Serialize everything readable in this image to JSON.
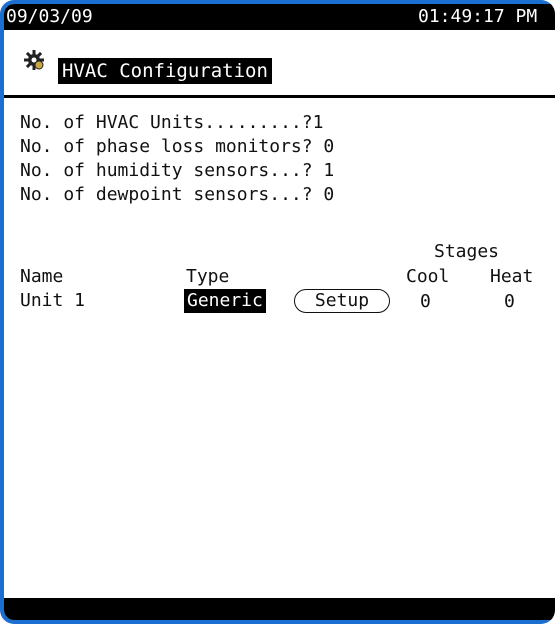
{
  "status": {
    "date": "09/03/09",
    "time": "01:49:17 PM"
  },
  "header": {
    "title": "HVAC Configuration",
    "icon": "gear-icon"
  },
  "config": {
    "lines": [
      "No. of HVAC Units.........?1",
      "No. of phase loss monitors? 0",
      "No. of humidity sensors...? 1",
      "No. of dewpoint sensors...? 0"
    ]
  },
  "table": {
    "group_header": "Stages",
    "headers": {
      "name": "Name",
      "type": "Type",
      "cool": "Cool",
      "heat": "Heat"
    },
    "rows": [
      {
        "name": "Unit 1",
        "type": "Generic",
        "setup_label": "Setup",
        "cool": "0",
        "heat": "0"
      }
    ]
  }
}
